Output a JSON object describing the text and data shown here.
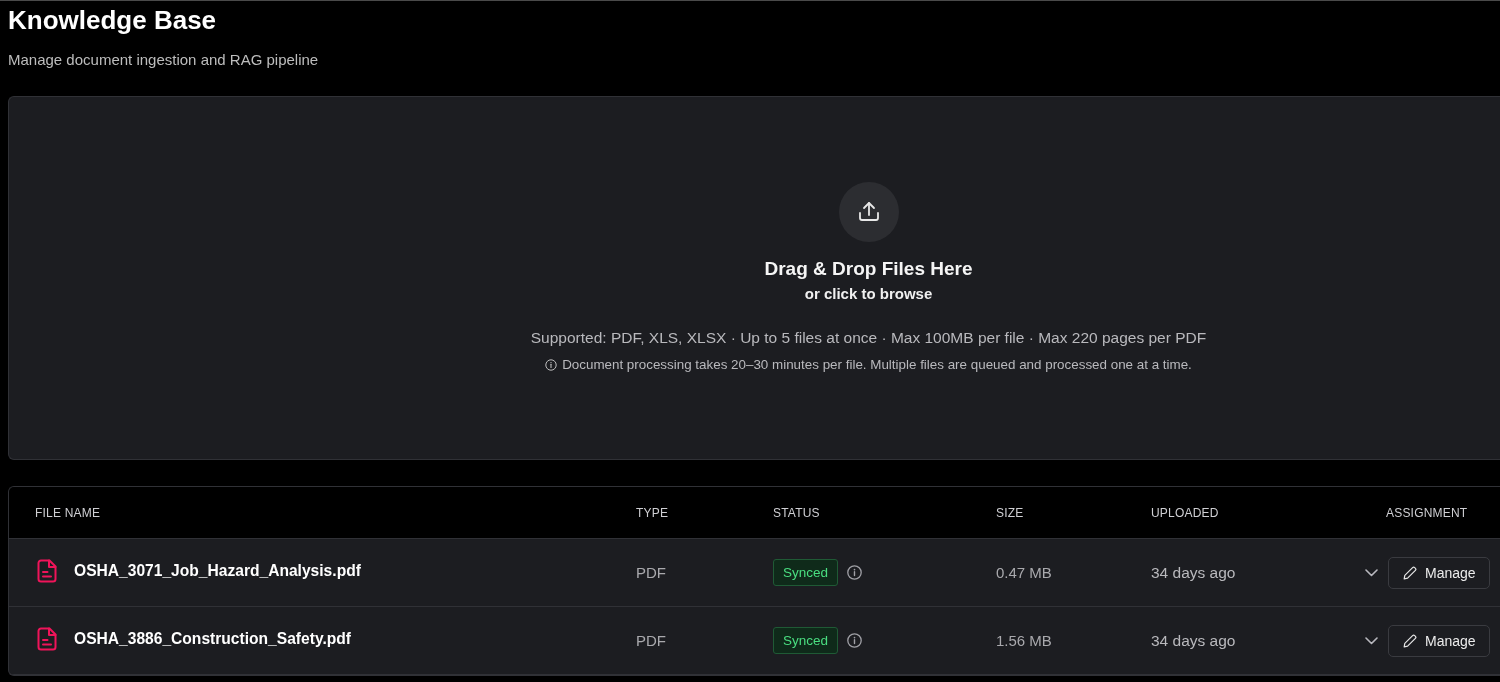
{
  "page": {
    "title": "Knowledge Base",
    "subtitle": "Manage document ingestion and RAG pipeline"
  },
  "upload": {
    "title": "Drag & Drop Files Here",
    "hint": "or click to browse",
    "supported": "Supported: PDF, XLS, XLSX · Up to 5 files at once · Max 100MB per file · Max 220 pages per PDF",
    "note": "Document processing takes 20–30 minutes per file. Multiple files are queued and processed one at a time."
  },
  "table": {
    "columns": [
      "FILE NAME",
      "TYPE",
      "STATUS",
      "SIZE",
      "UPLOADED",
      "ASSIGNMENT"
    ],
    "rows": [
      {
        "file_name": "OSHA_3071_Job_Hazard_Analysis.pdf",
        "type": "PDF",
        "status": {
          "label": "Synced",
          "kind": "synced"
        },
        "size": "0.47 MB",
        "uploaded": "34 days ago",
        "expanded": false,
        "action": "Manage"
      },
      {
        "file_name": "OSHA_3886_Construction_Safety.pdf",
        "type": "PDF",
        "status": {
          "label": "Synced",
          "kind": "synced"
        },
        "size": "1.56 MB",
        "uploaded": "34 days ago",
        "expanded": false,
        "action": "Manage"
      }
    ]
  }
}
